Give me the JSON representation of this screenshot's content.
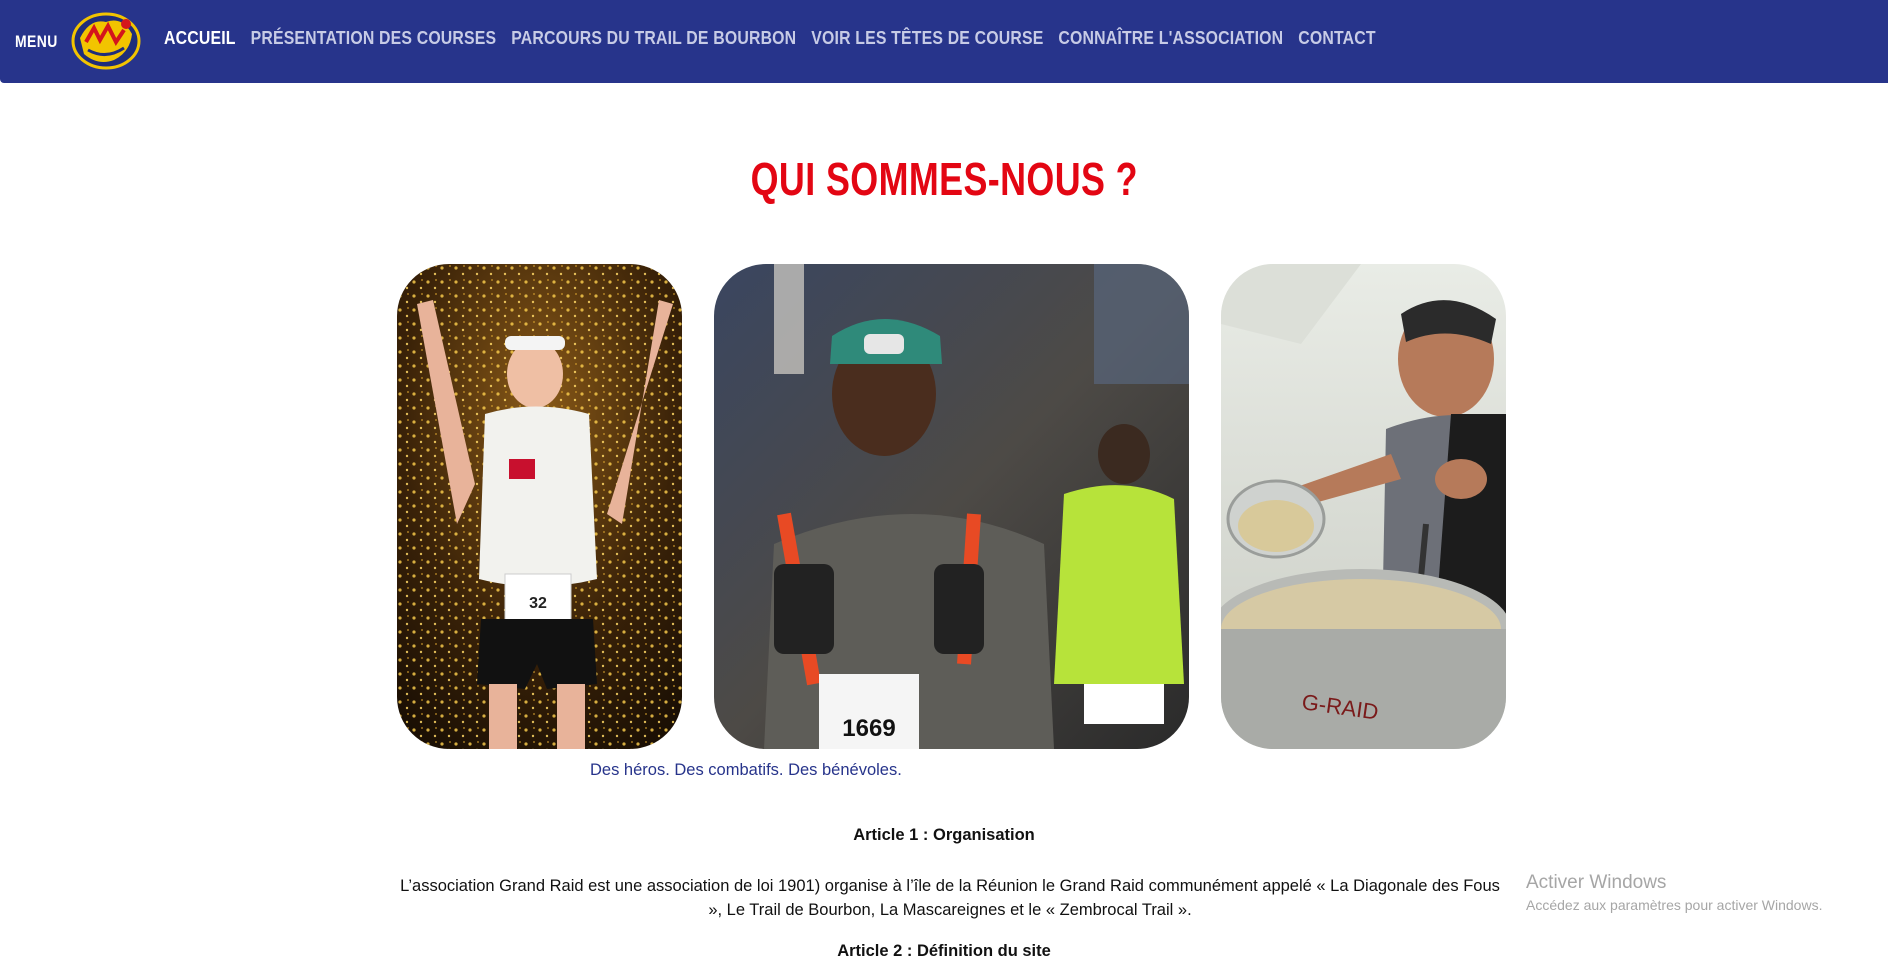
{
  "nav": {
    "menu_label": "MENU",
    "logo_alt": "Grand Raid logo",
    "links": [
      {
        "label": "ACCUEIL",
        "active": true
      },
      {
        "label": "PRÉSENTATION DES COURSES",
        "active": false
      },
      {
        "label": "PARCOURS DU TRAIL DE BOURBON",
        "active": false
      },
      {
        "label": "VOIR LES TÊTES DE COURSE",
        "active": false
      },
      {
        "label": "CONNAÎTRE L'ASSOCIATION",
        "active": false
      },
      {
        "label": "CONTACT",
        "active": false
      }
    ]
  },
  "section": {
    "title": "QUI SOMMES-NOUS ?",
    "caption": "Des héros. Des combatifs. Des bénévoles."
  },
  "photos": [
    {
      "name": "runner-finish-photo"
    },
    {
      "name": "trail-runners-photo"
    },
    {
      "name": "volunteer-cooking-photo"
    }
  ],
  "article": {
    "title": "Article 1 : Organisation",
    "body": "L’association Grand Raid est une association de loi 1901) organise à l’île de la Réunion le Grand Raid communément appelé « La Diagonale des Fous », Le Trail de Bourbon, La Mascareignes et le « Zembrocal Trail ».",
    "next_title": "Article 2 : Définition du site"
  },
  "windows_watermark": {
    "title": "Activer Windows",
    "subtitle": "Accédez aux paramètres pour activer Windows."
  },
  "colors": {
    "nav_bg": "#27348b",
    "title_red": "#e30613",
    "caption_blue": "#27348b"
  }
}
